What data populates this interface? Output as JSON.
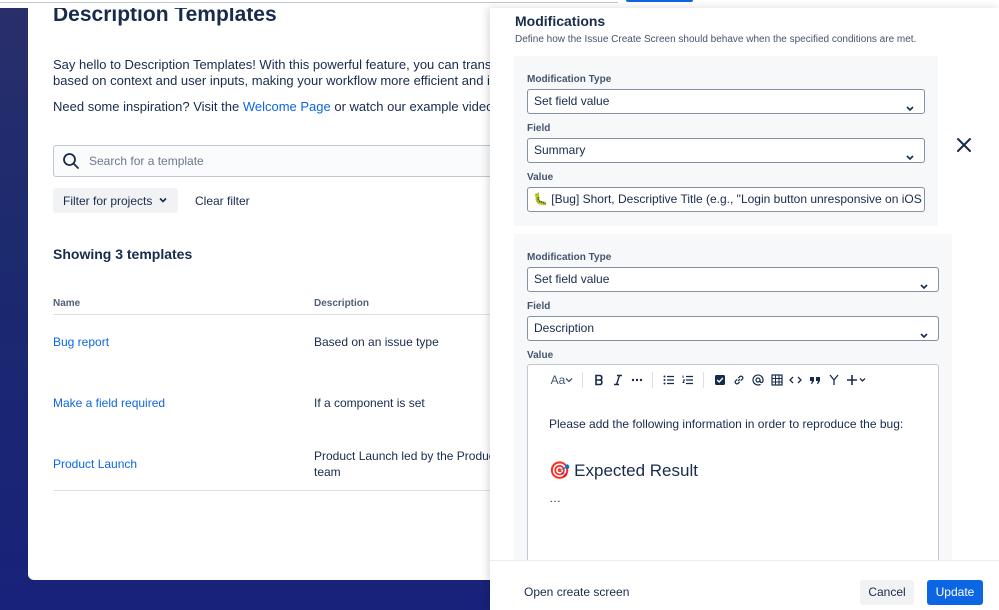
{
  "page": {
    "title": "Description Templates",
    "intro_line1": "Say hello to Description Templates! With this powerful feature, you can transform your",
    "intro_line2": "based on context and user inputs, making your workflow more efficient and intuitive.",
    "inspire_prefix": "Need some inspiration? Visit the ",
    "inspire_link": "Welcome Page",
    "inspire_suffix": " or watch our example videos to get sta",
    "search_placeholder": "Search for a template",
    "filter_label": "Filter for projects",
    "clear_filter": "Clear filter",
    "showing": "Showing 3 templates",
    "columns": {
      "name": "Name",
      "description": "Description"
    },
    "rows": [
      {
        "name": "Bug report",
        "description": "Based on an issue type"
      },
      {
        "name": "Make a field required",
        "description": "If a component is set"
      },
      {
        "name": "Product Launch",
        "description": "Product Launch led by the Product\nteam"
      }
    ]
  },
  "drawer": {
    "title": "Modifications",
    "subtitle": "Define how the Issue Create Screen should behave when the specified conditions are met.",
    "mod1": {
      "type_label": "Modification Type",
      "type_value": "Set field value",
      "field_label": "Field",
      "field_value": "Summary",
      "value_label": "Value",
      "value_text": "🐛 [Bug] Short, Descriptive Title (e.g., \"Login button unresponsive on iOS Chr"
    },
    "mod2": {
      "type_label": "Modification Type",
      "type_value": "Set field value",
      "field_label": "Field",
      "field_value": "Description",
      "value_label": "Value",
      "editor": {
        "text_style": "Aa",
        "paragraph": "Please add the following information in order to reproduce the bug:",
        "heading_emoji": "🎯",
        "heading": "Expected Result",
        "ellipsis": "…"
      }
    },
    "footer": {
      "open_create": "Open create screen",
      "cancel": "Cancel",
      "update": "Update"
    }
  },
  "colors": {
    "brand_blue": "#0c66e4",
    "text": "#172b4d",
    "background_gradient": "#1c2a6e"
  }
}
